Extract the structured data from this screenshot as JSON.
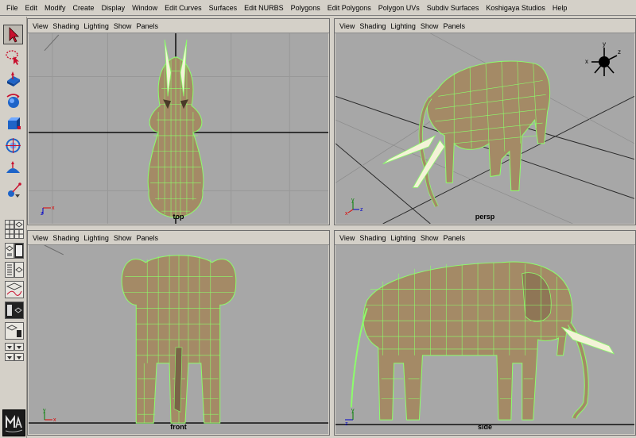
{
  "menubar": {
    "items": [
      "File",
      "Edit",
      "Modify",
      "Create",
      "Display",
      "Window",
      "Edit Curves",
      "Surfaces",
      "Edit NURBS",
      "Polygons",
      "Edit Polygons",
      "Polygon UVs",
      "Subdiv Surfaces",
      "Koshigaya Studios",
      "Help"
    ]
  },
  "toolbox": {
    "tools": [
      {
        "icon": "select-arrow-icon",
        "active": true
      },
      {
        "icon": "lasso-select-icon"
      },
      {
        "icon": "move-tool-icon"
      },
      {
        "icon": "rotate-tool-icon"
      },
      {
        "icon": "scale-tool-icon"
      },
      {
        "icon": "universal-manipulator-icon"
      },
      {
        "icon": "soft-modification-icon"
      },
      {
        "icon": "show-manipulator-icon"
      }
    ],
    "logo": "Maya"
  },
  "panel_menu": [
    "View",
    "Shading",
    "Lighting",
    "Show",
    "Panels"
  ],
  "viewports": {
    "top": {
      "label": "top",
      "axes": [
        "x",
        "z"
      ]
    },
    "persp": {
      "label": "persp",
      "axes": [
        "x",
        "y",
        "z"
      ]
    },
    "front": {
      "label": "front",
      "axes": [
        "x",
        "y"
      ]
    },
    "side": {
      "label": "side",
      "axes": [
        "z",
        "y"
      ]
    }
  },
  "view_cube": {
    "labels": [
      "y",
      "x",
      "z"
    ]
  },
  "colors": {
    "ui_gray": "#d4d0c8",
    "viewport_gray": "#a7a7a7",
    "wire_green": "#8cff6a",
    "elephant_skin": "#a48a66",
    "tusk": "#f4f2d8"
  }
}
